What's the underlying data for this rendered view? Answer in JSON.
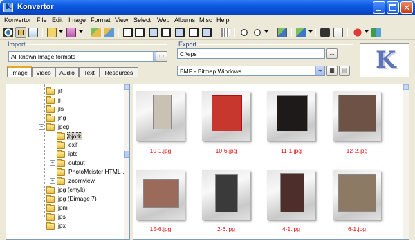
{
  "window": {
    "title": "Konvertor",
    "app_letter": "K"
  },
  "menu": [
    "Konvertor",
    "File",
    "Edit",
    "Image",
    "Format",
    "View",
    "Select",
    "Web",
    "Albums",
    "Misc",
    "Help"
  ],
  "import": {
    "label": "Import",
    "format_value": "All known Image formats",
    "tabs": [
      "Image",
      "Video",
      "Audio",
      "Text",
      "Resources"
    ],
    "active_tab": "Image"
  },
  "export": {
    "label": "Export",
    "path_value": "C:\\eps",
    "browse_label": "...",
    "format_value": "BMP - Bitmap Windows"
  },
  "logo_letter": "K",
  "tree": [
    {
      "label": "jif"
    },
    {
      "label": "jj"
    },
    {
      "label": "jls"
    },
    {
      "label": "jng"
    },
    {
      "label": "jpeg"
    },
    {
      "label": "bjork"
    },
    {
      "label": "exif"
    },
    {
      "label": "iptc"
    },
    {
      "label": "output"
    },
    {
      "label": "PhotoMeister HTML-..."
    },
    {
      "label": "zoomview"
    },
    {
      "label": "jpg (cmyk)"
    },
    {
      "label": "jpg (Dimage 7)"
    },
    {
      "label": "jpm"
    },
    {
      "label": "jps"
    },
    {
      "label": "jpx"
    }
  ],
  "thumbnails": [
    {
      "name": "10-1.jpg",
      "photo_color": "#C9C1B3"
    },
    {
      "name": "10-6.jpg",
      "photo_color": "#C7372E"
    },
    {
      "name": "11-1.jpg",
      "photo_color": "#1E1A1A"
    },
    {
      "name": "12-2.jpg",
      "photo_color": "#6E5246"
    },
    {
      "name": "15-6.jpg",
      "photo_color": "#9A6B5B"
    },
    {
      "name": "2-6.jpg",
      "photo_color": "#3A3A3A"
    },
    {
      "name": "4-1.jpg",
      "photo_color": "#4E2E2A"
    },
    {
      "name": "6-1.jpg",
      "photo_color": "#8C7A64"
    }
  ],
  "colors": {
    "title_bar": "#0A58E0",
    "filename_red": "#E41010",
    "selection": "#D4D0C8"
  }
}
